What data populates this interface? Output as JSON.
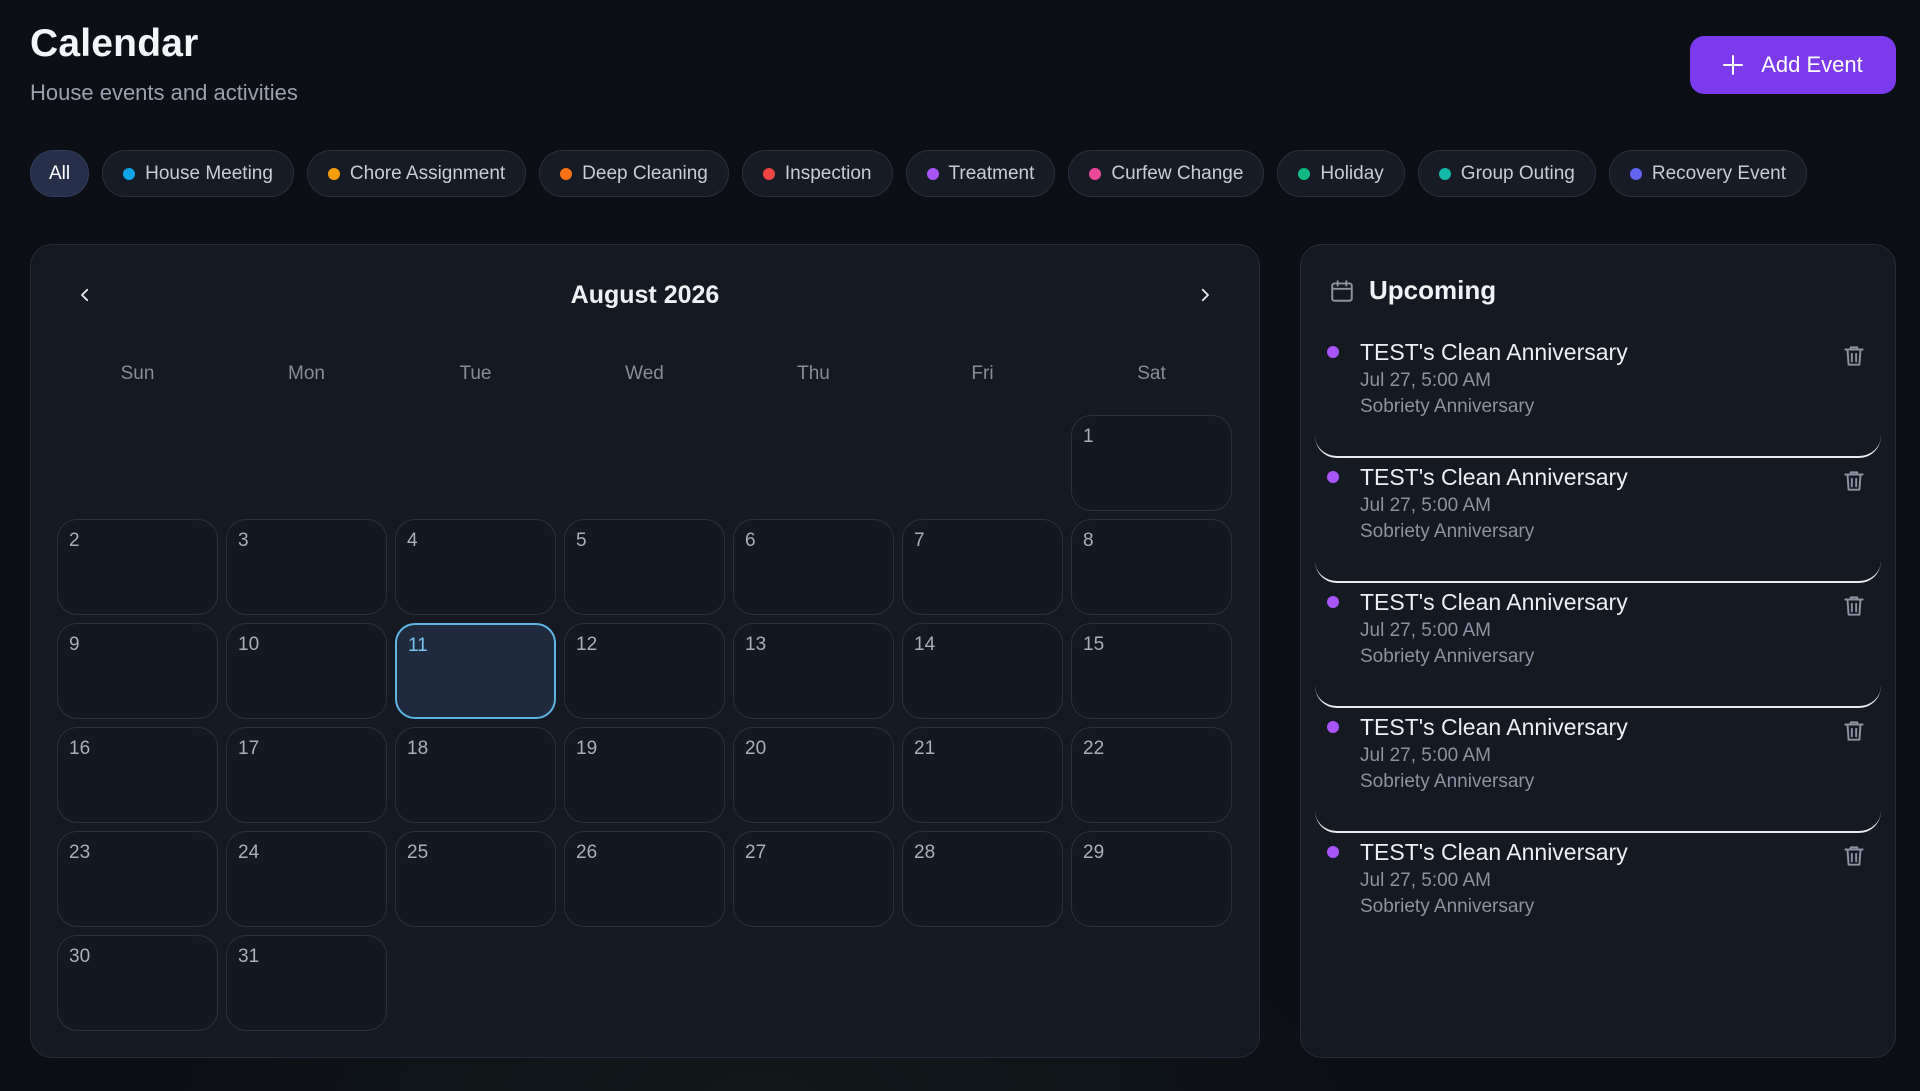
{
  "header": {
    "title": "Calendar",
    "subtitle": "House events and activities",
    "add_button": "Add Event"
  },
  "filters": [
    {
      "label": "All",
      "active": true,
      "color": ""
    },
    {
      "label": "House Meeting",
      "active": false,
      "color": "#0ea5e9"
    },
    {
      "label": "Chore Assignment",
      "active": false,
      "color": "#f59e0b"
    },
    {
      "label": "Deep Cleaning",
      "active": false,
      "color": "#f97316"
    },
    {
      "label": "Inspection",
      "active": false,
      "color": "#ef4444"
    },
    {
      "label": "Treatment",
      "active": false,
      "color": "#a855f7"
    },
    {
      "label": "Curfew Change",
      "active": false,
      "color": "#ec4899"
    },
    {
      "label": "Holiday",
      "active": false,
      "color": "#10b981"
    },
    {
      "label": "Group Outing",
      "active": false,
      "color": "#14b8a6"
    },
    {
      "label": "Recovery Event",
      "active": false,
      "color": "#6366f1"
    }
  ],
  "calendar": {
    "month_label": "August 2026",
    "weekdays": [
      "Sun",
      "Mon",
      "Tue",
      "Wed",
      "Thu",
      "Fri",
      "Sat"
    ],
    "leading_blanks": 6,
    "days_in_month": 31,
    "today": 11
  },
  "upcoming": {
    "title": "Upcoming",
    "dot_color": "#a855f7",
    "events": [
      {
        "name": "TEST's Clean Anniversary",
        "time": "Jul 27, 5:00 AM",
        "type": "Sobriety Anniversary"
      },
      {
        "name": "TEST's Clean Anniversary",
        "time": "Jul 27, 5:00 AM",
        "type": "Sobriety Anniversary"
      },
      {
        "name": "TEST's Clean Anniversary",
        "time": "Jul 27, 5:00 AM",
        "type": "Sobriety Anniversary"
      },
      {
        "name": "TEST's Clean Anniversary",
        "time": "Jul 27, 5:00 AM",
        "type": "Sobriety Anniversary"
      },
      {
        "name": "TEST's Clean Anniversary",
        "time": "Jul 27, 5:00 AM",
        "type": "Sobriety Anniversary"
      }
    ]
  }
}
